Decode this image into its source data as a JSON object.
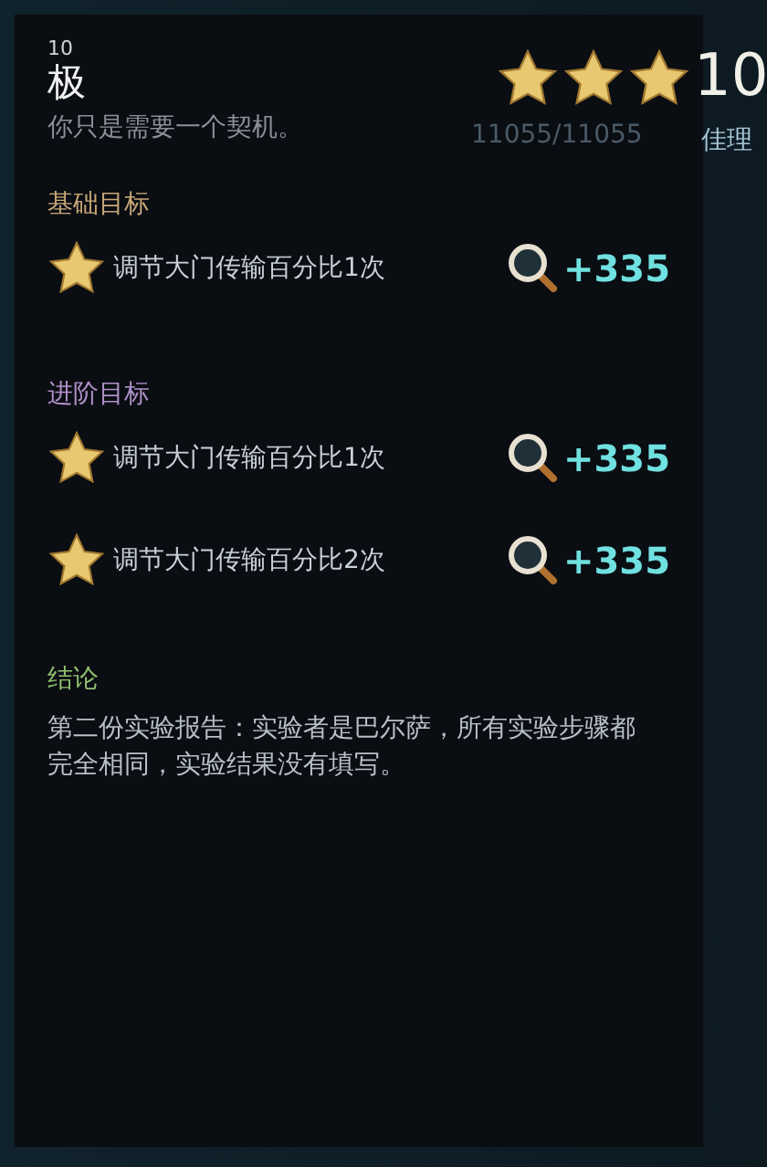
{
  "header": {
    "level": "10",
    "title": "极",
    "subtitle": "你只是需要一个契机。"
  },
  "rating": {
    "stars": 3,
    "score": "10",
    "counter": "11055/11055",
    "tag": "佳理"
  },
  "sections": [
    {
      "title": "基础目标",
      "color": "#c8a878",
      "goals": [
        {
          "text": "调节大门传输百分比1次",
          "reward": "+335"
        }
      ]
    },
    {
      "title": "进阶目标",
      "color": "#b090c8",
      "goals": [
        {
          "text": "调节大门传输百分比1次",
          "reward": "+335"
        },
        {
          "text": "调节大门传输百分比2次",
          "reward": "+335"
        }
      ]
    }
  ],
  "conclusion": {
    "title": "结论",
    "text": "第二份实验报告：实验者是巴尔萨，所有实验步骤都完全相同，实验结果没有填写。"
  }
}
